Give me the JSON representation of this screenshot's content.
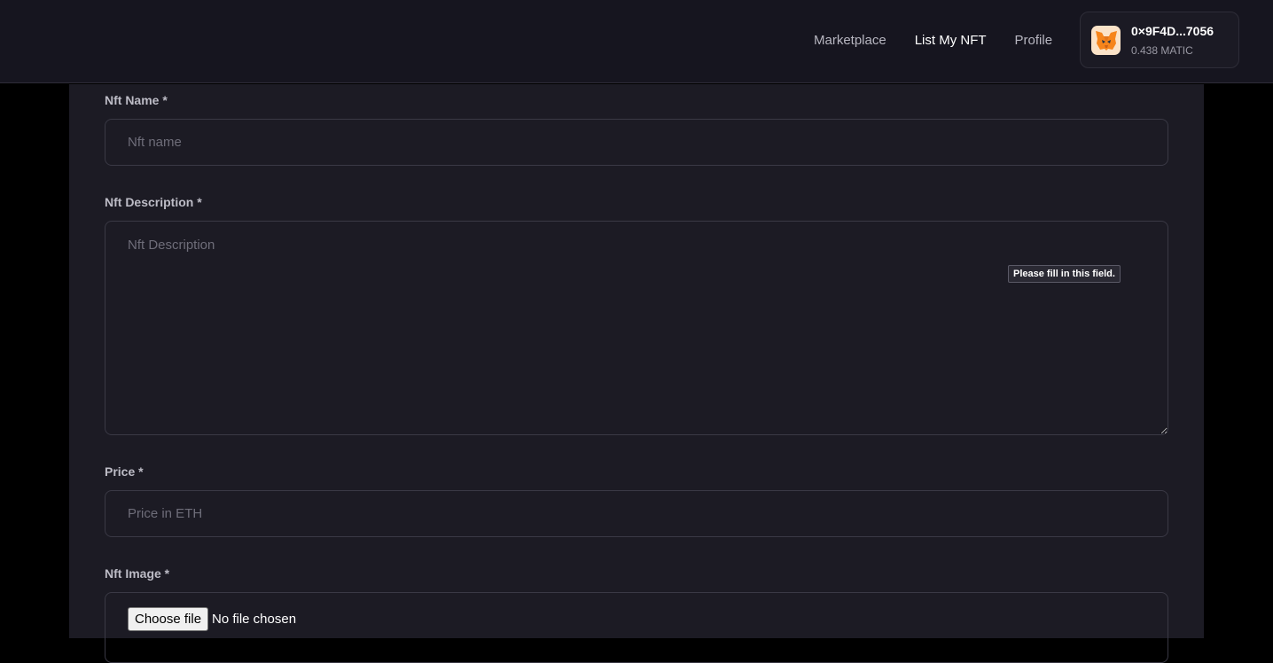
{
  "nav": {
    "items": [
      {
        "label": "Marketplace",
        "active": false
      },
      {
        "label": "List My NFT",
        "active": true
      },
      {
        "label": "Profile",
        "active": false
      }
    ]
  },
  "wallet": {
    "icon": "metamask-fox-icon",
    "address": "0×9F4D...7056",
    "balance": "0.438 MATIC"
  },
  "form": {
    "name_label": "Nft Name *",
    "name_placeholder": "Nft name",
    "description_label": "Nft Description *",
    "description_placeholder": "Nft Description",
    "validation_tooltip": "Please fill in this field.",
    "price_label": "Price *",
    "price_placeholder": "Price in ETH",
    "image_label": "Nft Image *",
    "file_button": "Choose file",
    "file_status": "No file chosen"
  },
  "colors": {
    "background": "#000000",
    "topbar": "#16151f",
    "panel": "#1c1b24",
    "border": "#3a3945"
  }
}
